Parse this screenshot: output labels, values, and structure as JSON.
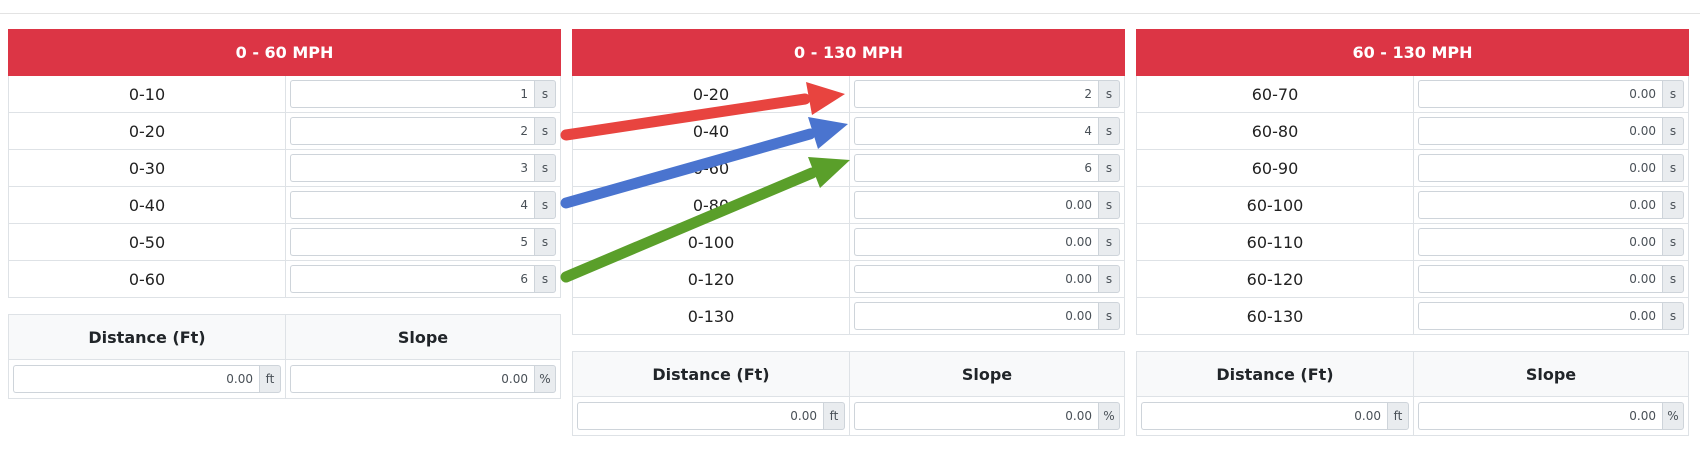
{
  "panels": [
    {
      "title": "0 - 60 MPH",
      "rows": [
        {
          "range": "0-10",
          "value": "1",
          "unit": "s"
        },
        {
          "range": "0-20",
          "value": "2",
          "unit": "s"
        },
        {
          "range": "0-30",
          "value": "3",
          "unit": "s"
        },
        {
          "range": "0-40",
          "value": "4",
          "unit": "s"
        },
        {
          "range": "0-50",
          "value": "5",
          "unit": "s"
        },
        {
          "range": "0-60",
          "value": "6",
          "unit": "s"
        }
      ],
      "distance": {
        "label": "Distance (Ft)",
        "value": "0.00",
        "unit": "ft"
      },
      "slope": {
        "label": "Slope",
        "value": "0.00",
        "unit": "%"
      }
    },
    {
      "title": "0 - 130 MPH",
      "rows": [
        {
          "range": "0-20",
          "value": "2",
          "unit": "s"
        },
        {
          "range": "0-40",
          "value": "4",
          "unit": "s"
        },
        {
          "range": "0-60",
          "value": "6",
          "unit": "s"
        },
        {
          "range": "0-80",
          "value": "0.00",
          "unit": "s"
        },
        {
          "range": "0-100",
          "value": "0.00",
          "unit": "s"
        },
        {
          "range": "0-120",
          "value": "0.00",
          "unit": "s"
        },
        {
          "range": "0-130",
          "value": "0.00",
          "unit": "s"
        }
      ],
      "distance": {
        "label": "Distance (Ft)",
        "value": "0.00",
        "unit": "ft"
      },
      "slope": {
        "label": "Slope",
        "value": "0.00",
        "unit": "%"
      }
    },
    {
      "title": "60 - 130 MPH",
      "rows": [
        {
          "range": "60-70",
          "value": "0.00",
          "unit": "s"
        },
        {
          "range": "60-80",
          "value": "0.00",
          "unit": "s"
        },
        {
          "range": "60-90",
          "value": "0.00",
          "unit": "s"
        },
        {
          "range": "60-100",
          "value": "0.00",
          "unit": "s"
        },
        {
          "range": "60-110",
          "value": "0.00",
          "unit": "s"
        },
        {
          "range": "60-120",
          "value": "0.00",
          "unit": "s"
        },
        {
          "range": "60-130",
          "value": "0.00",
          "unit": "s"
        }
      ],
      "distance": {
        "label": "Distance (Ft)",
        "value": "0.00",
        "unit": "ft"
      },
      "slope": {
        "label": "Slope",
        "value": "0.00",
        "unit": "%"
      }
    }
  ],
  "colors": {
    "header_bg": "#dc3545",
    "arrow_red": "#e8443f",
    "arrow_blue": "#4a74cf",
    "arrow_green": "#5a9f2a"
  },
  "annotations": [
    {
      "color": "arrow_red",
      "from": "panel0-row1",
      "to": "panel1-row0"
    },
    {
      "color": "arrow_blue",
      "from": "panel0-row3",
      "to": "panel1-row1"
    },
    {
      "color": "arrow_green",
      "from": "panel0-row5",
      "to": "panel1-row2"
    }
  ]
}
